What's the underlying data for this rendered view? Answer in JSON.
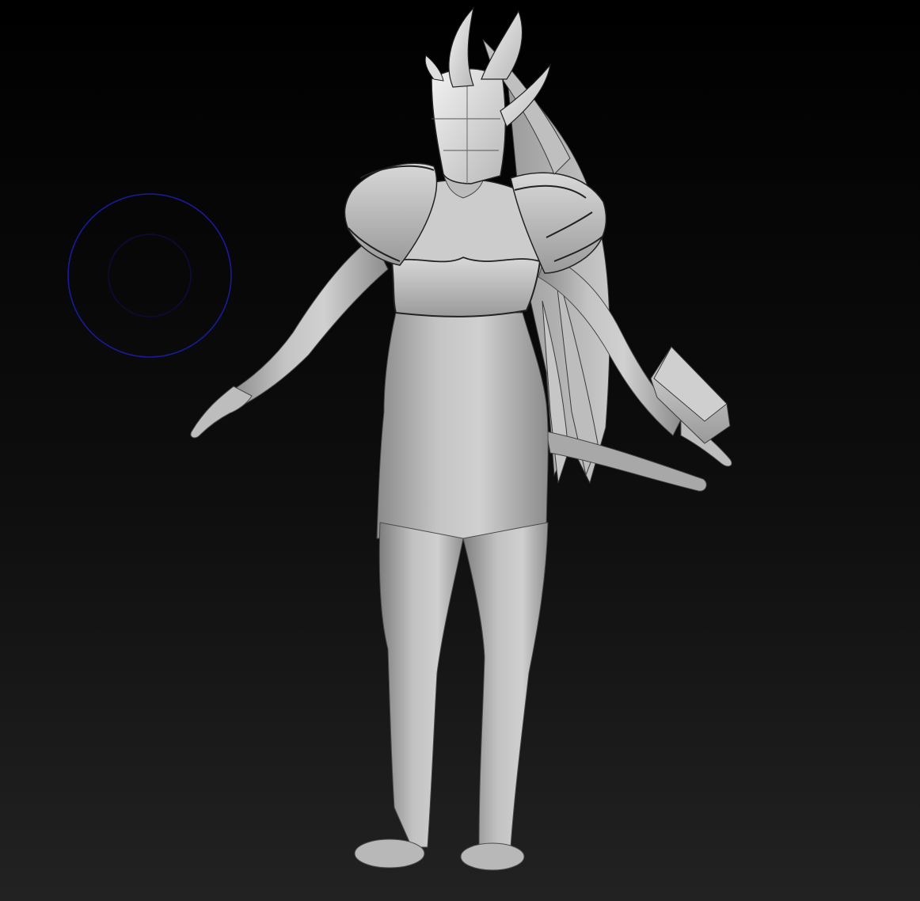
{
  "app": {
    "view": "3d-sculpt-viewport"
  },
  "viewport": {
    "background_top": "#000000",
    "background_bottom": "#222222",
    "model_color": "#b4b4b4",
    "model_highlight": "#e6e6e6",
    "model_shadow": "#6e6e6e",
    "seam_color": "#1c1c1c"
  },
  "brush_cursor": {
    "outer_color": "#1a1a9a",
    "inner_color": "#0c0c3a"
  },
  "icons": {
    "brush_cursor": "brush-cursor-icon",
    "model": "sculpt-model-icon"
  }
}
